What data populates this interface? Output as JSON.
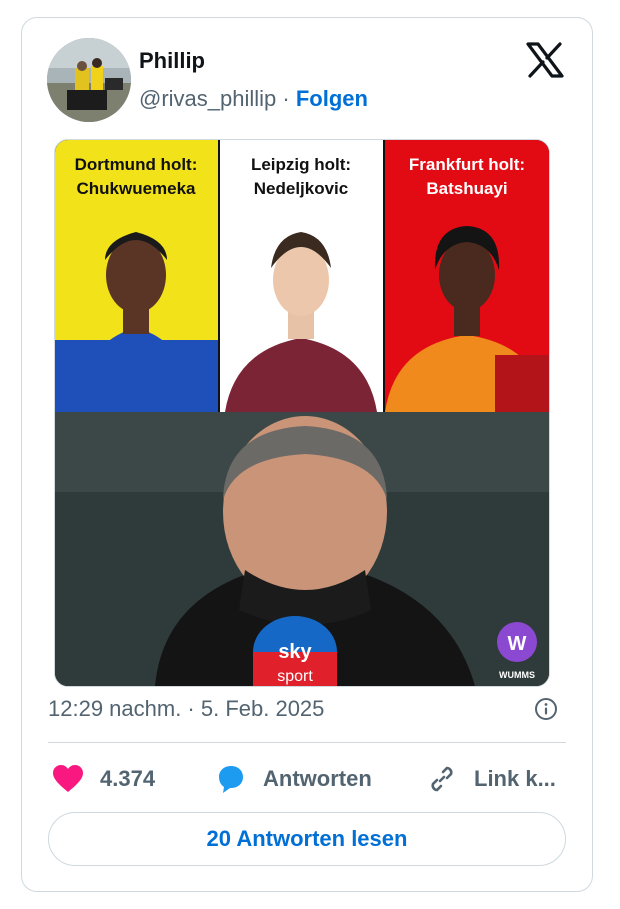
{
  "author": {
    "name": "Phillip",
    "handle": "@rivas_phillip",
    "separator": "·",
    "follow_label": "Folgen"
  },
  "platform_icon": "x-logo-icon",
  "media": {
    "panels": [
      {
        "line1": "Dortmund holt:",
        "line2": "Chukwuemeka",
        "bg": "#f2e21a",
        "text_color": "#111111"
      },
      {
        "line1": "Leipzig holt:",
        "line2": "Nedeljkovic",
        "bg": "#ffffff",
        "text_color": "#111111"
      },
      {
        "line1": "Frankfurt holt:",
        "line2": "Batshuayi",
        "bg": "#e30b13",
        "text_color": "#ffffff"
      }
    ],
    "mic_label_top": "sky",
    "mic_label_bottom": "sport",
    "watermark": "WUMMS"
  },
  "timestamp": "12:29 nachm. · 5. Feb. 2025",
  "actions": {
    "likes": "4.374",
    "reply_label": "Antworten",
    "link_label": "Link k..."
  },
  "read_replies_label": "20 Antworten lesen",
  "colors": {
    "accent": "#006fd6",
    "like": "#f91880",
    "reply_bubble": "#1d9bf0",
    "muted": "#536471"
  }
}
